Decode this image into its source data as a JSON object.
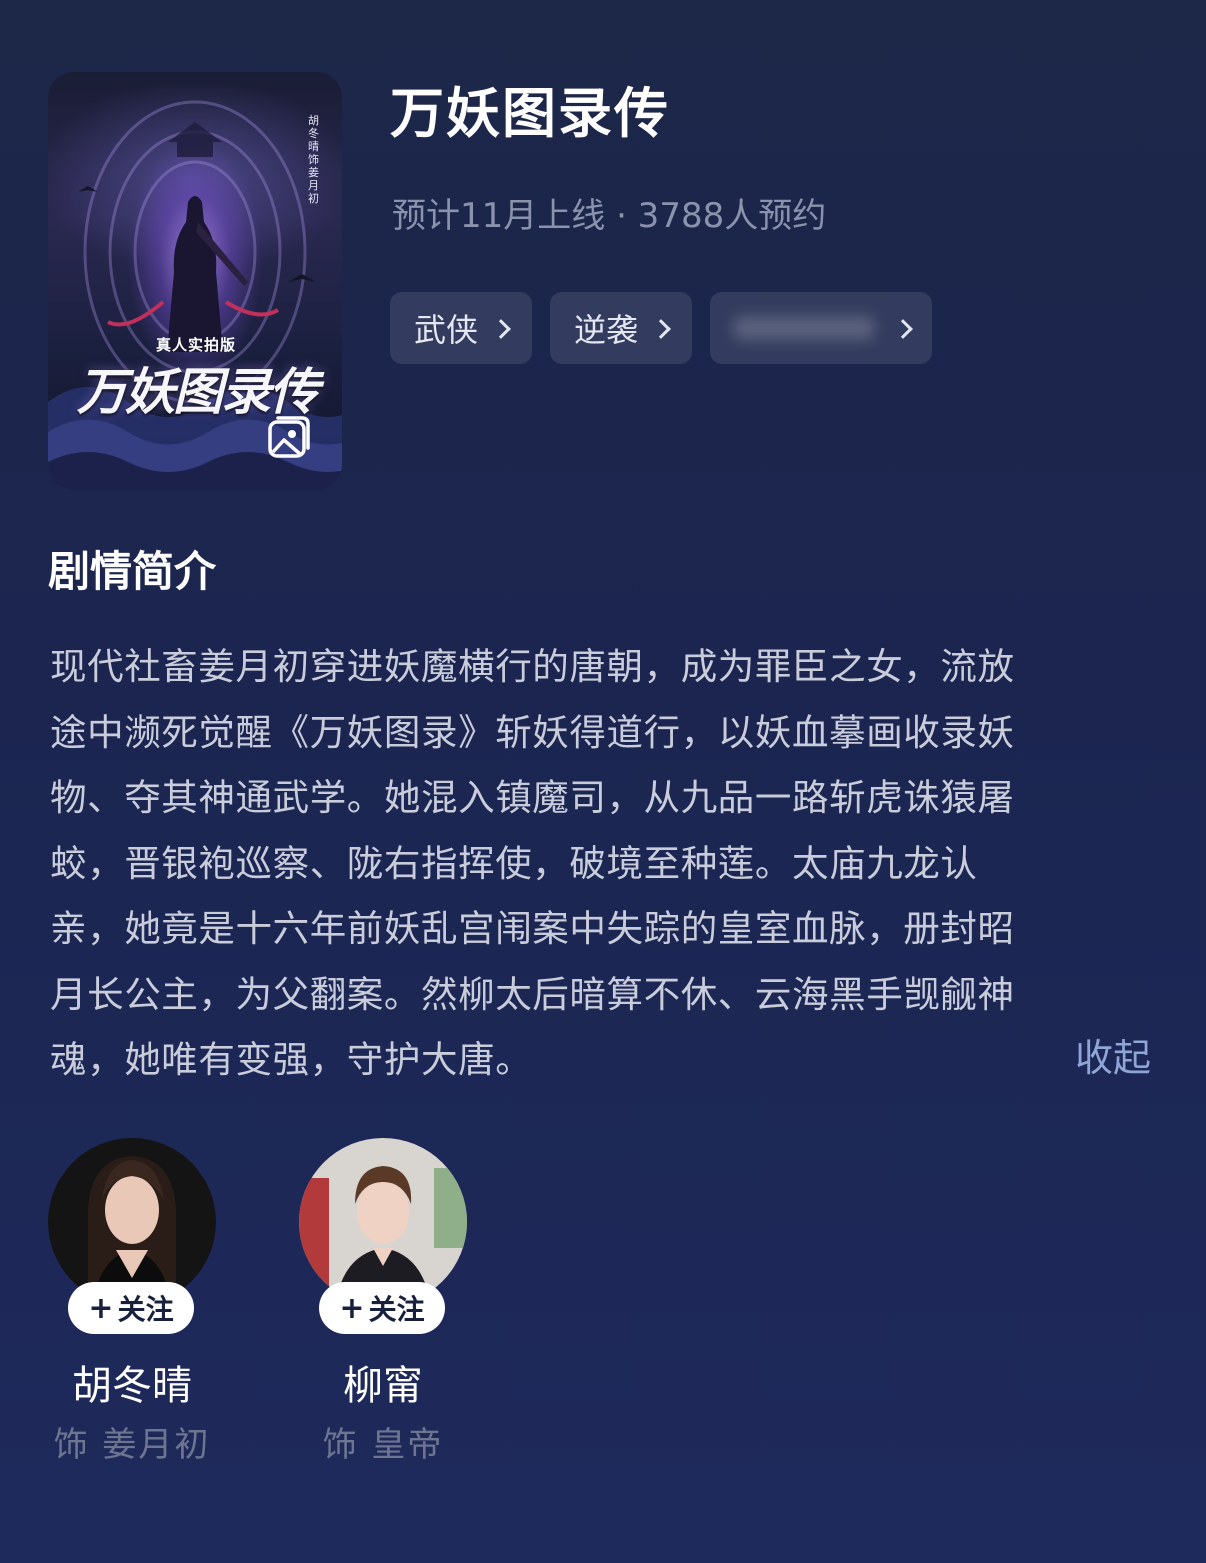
{
  "poster": {
    "vertical_text": "胡冬晴饰姜月初",
    "subtitle": "真人实拍版",
    "title_art": "万妖图录传"
  },
  "show": {
    "title": "万妖图录传",
    "meta": "预计11月上线 · 3788人预约"
  },
  "tags": [
    {
      "label": "武侠",
      "icon": "chevron-right-icon"
    },
    {
      "label": "逆袭",
      "icon": "chevron-right-icon"
    },
    {
      "label": "",
      "blurred": true,
      "icon": "chevron-right-icon"
    }
  ],
  "synopsis": {
    "heading": "剧情简介",
    "lines": [
      "现代社畜姜月初穿进妖魔横行的唐朝，成为罪臣之女，流放",
      "途中濒死觉醒《万妖图录》斩妖得道行，以妖血摹画收录妖",
      "物、夺其神通武学。她混入镇魔司，从九品一路斩虎诛猿屠",
      "蛟，晋银袍巡察、陇右指挥使，破境至种莲。太庙九龙认",
      "亲，她竟是十六年前妖乱宫闱案中失踪的皇室血脉，册封昭",
      "月长公主，为父翻案。然柳太后暗算不休、云海黑手觊觎神",
      "魂，她唯有变强，守护大唐。"
    ],
    "collapse_label": "收起"
  },
  "cast": [
    {
      "name": "胡冬晴",
      "role": "饰 姜月初",
      "follow_label": "关注",
      "follow_icon": "plus-icon"
    },
    {
      "name": "柳甯",
      "role": "饰 皇帝",
      "follow_label": "关注",
      "follow_icon": "plus-icon"
    }
  ],
  "colors": {
    "background": "#1b2550",
    "meta_text": "#8b92ab",
    "synopsis_text": "#c9cddb",
    "link": "#8fa5d6",
    "role_text": "#6d7591"
  }
}
